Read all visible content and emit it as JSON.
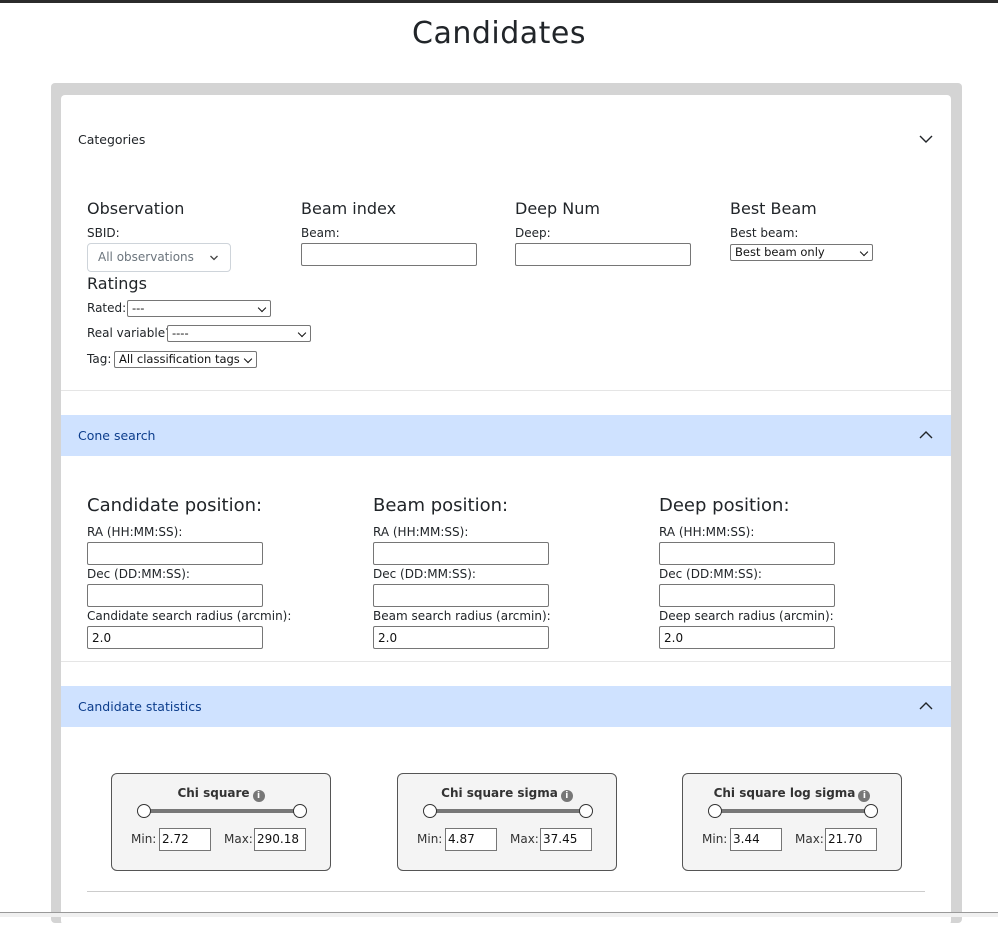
{
  "page": {
    "title": "Candidates"
  },
  "categories": {
    "header": "Categories",
    "observation": {
      "heading": "Observation",
      "sbid_label": "SBID:",
      "sbid_value": "All observations"
    },
    "beam_index": {
      "heading": "Beam index",
      "beam_label": "Beam:",
      "beam_value": ""
    },
    "deep_num": {
      "heading": "Deep Num",
      "deep_label": "Deep:",
      "deep_value": ""
    },
    "best_beam": {
      "heading": "Best Beam",
      "label": "Best beam:",
      "value": "Best beam only"
    },
    "ratings": {
      "heading": "Ratings",
      "rated_label": "Rated:",
      "rated_value": "---",
      "real_label": "Real variable?",
      "real_value": "----",
      "tag_label": "Tag:",
      "tag_value": "All classification tags"
    }
  },
  "cone_search": {
    "header": "Cone search",
    "candidate": {
      "heading": "Candidate position:",
      "ra_label": "RA (HH:MM:SS):",
      "ra_value": "",
      "dec_label": "Dec (DD:MM:SS):",
      "dec_value": "",
      "radius_label": "Candidate search radius (arcmin):",
      "radius_value": "2.0"
    },
    "beam": {
      "heading": "Beam position:",
      "ra_label": "RA (HH:MM:SS):",
      "ra_value": "",
      "dec_label": "Dec (DD:MM:SS):",
      "dec_value": "",
      "radius_label": "Beam search radius (arcmin):",
      "radius_value": "2.0"
    },
    "deep": {
      "heading": "Deep position:",
      "ra_label": "RA (HH:MM:SS):",
      "ra_value": "",
      "dec_label": "Dec (DD:MM:SS):",
      "dec_value": "",
      "radius_label": "Deep search radius (arcmin):",
      "radius_value": "2.0"
    }
  },
  "candidate_statistics": {
    "header": "Candidate statistics",
    "sliders": [
      {
        "title": "Chi square",
        "min_label": "Min:",
        "min_value": "2.72",
        "max_label": "Max:",
        "max_value": "290.18"
      },
      {
        "title": "Chi square sigma",
        "min_label": "Min:",
        "min_value": "4.87",
        "max_label": "Max:",
        "max_value": "37.45"
      },
      {
        "title": "Chi square log sigma",
        "min_label": "Min:",
        "min_value": "3.44",
        "max_label": "Max:",
        "max_value": "21.70"
      }
    ]
  },
  "colors": {
    "accordion_open_bg": "#cfe2ff",
    "accordion_open_text": "#0c3d8c",
    "outer_bg": "#d4d4d4"
  },
  "icons": {
    "chevron": "chevron-icon",
    "info": "info-icon",
    "dropdown": "chevron-down-icon"
  }
}
